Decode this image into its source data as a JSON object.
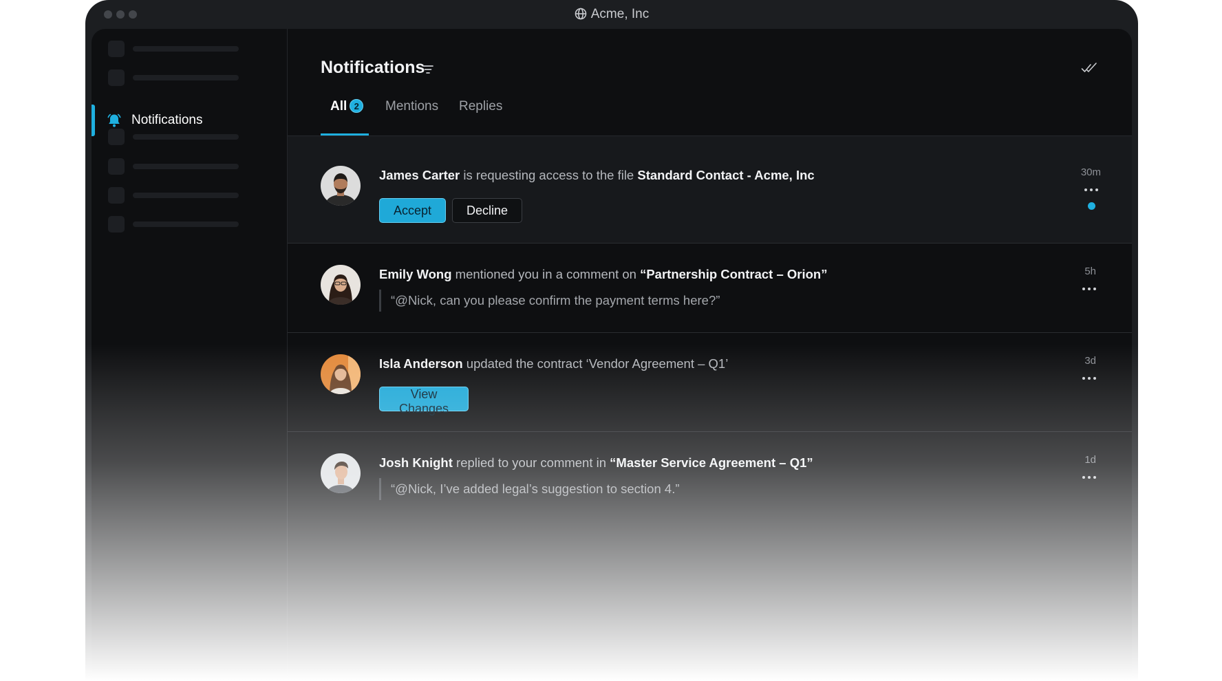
{
  "window": {
    "title": "Acme, Inc"
  },
  "sidebar": {
    "active_item": {
      "label": "Notifications",
      "icon": "bell-icon"
    }
  },
  "header": {
    "title": "Notifications",
    "filter_icon": "filter-icon",
    "mark_read_icon": "double-check-icon"
  },
  "tabs": [
    {
      "label": "All",
      "badge": "2",
      "active": true
    },
    {
      "label": "Mentions",
      "active": false
    },
    {
      "label": "Replies",
      "active": false
    }
  ],
  "notifications": [
    {
      "user": "James Carter",
      "action": " is requesting access to the file ",
      "target": "Standard Contact - Acme, Inc",
      "time": "30m",
      "unread": true,
      "actions": {
        "accept": "Accept",
        "decline": "Decline"
      }
    },
    {
      "user": "Emily Wong",
      "action": " mentioned you in a comment on ",
      "target": "“Partnership Contract – Orion”",
      "time": "5h",
      "quote": "“@Nick, can you please confirm the payment terms here?”"
    },
    {
      "user": "Isla Anderson",
      "action": " updated the contract ‘Vendor Agreement – Q1’",
      "time": "3d",
      "button": "View Changes"
    },
    {
      "user": "Josh Knight",
      "action": " replied to your comment in ",
      "target": "“Master Service Agreement – Q1”",
      "time": "1d",
      "quote": "“@Nick, I’ve added legal’s suggestion to section 4.”"
    }
  ],
  "colors": {
    "accent": "#1fb0e0",
    "background": "#0e0f11",
    "frame": "#1c1e21"
  }
}
